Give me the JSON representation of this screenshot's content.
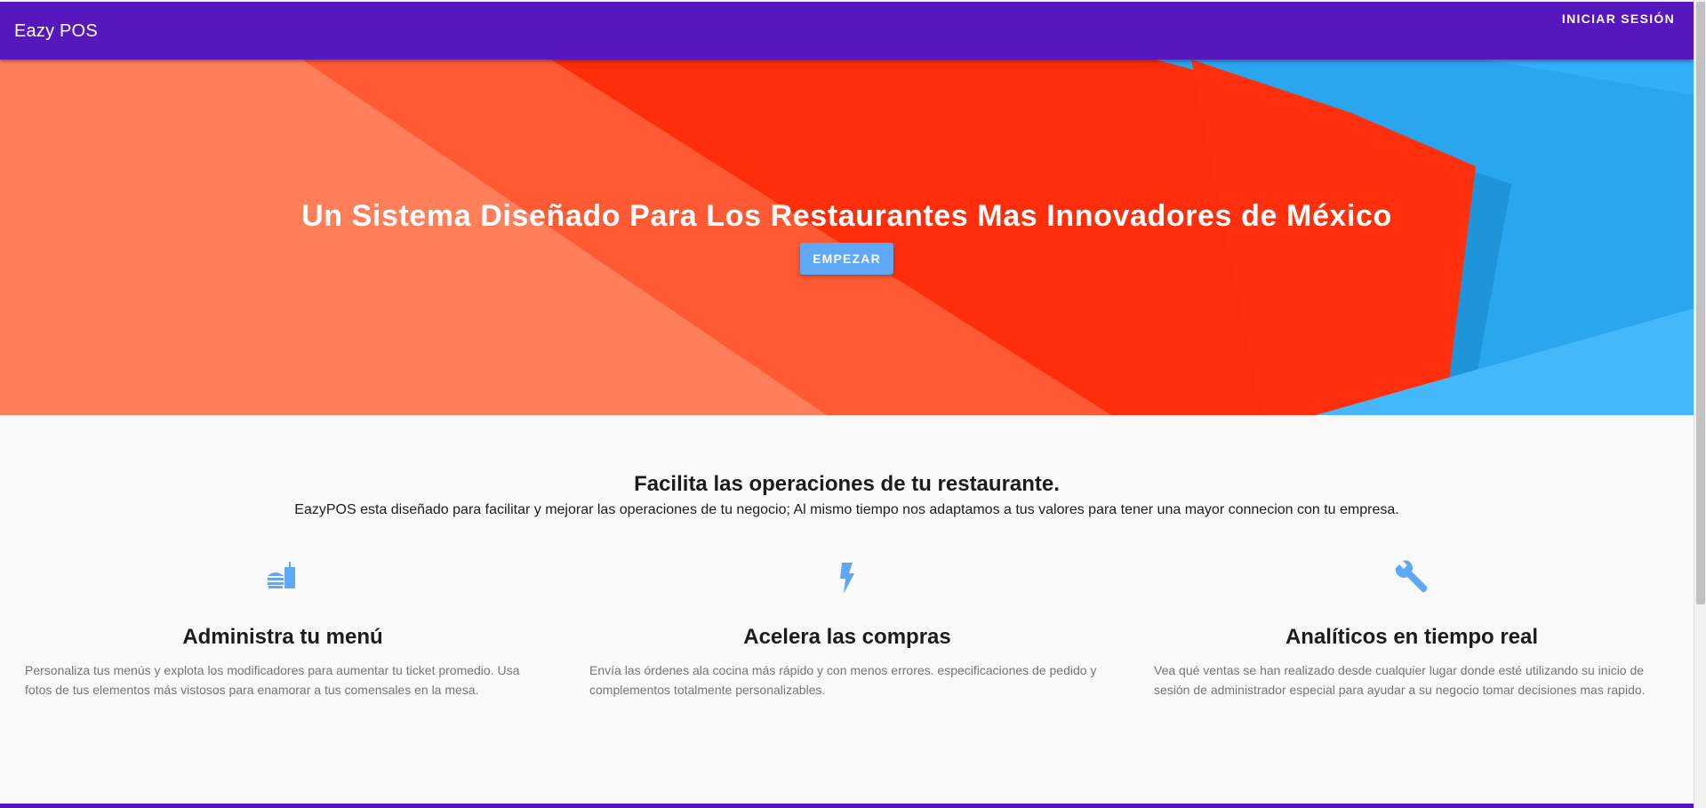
{
  "appbar": {
    "brand": "Eazy POS",
    "login_label": "INICIAR SESIÓN"
  },
  "hero": {
    "headline": "Un Sistema Diseñado Para Los Restaurantes Mas Innovadores de México",
    "cta_label": "EMPEZAR"
  },
  "intro": {
    "title": "Facilita las operaciones de tu restaurante.",
    "description": "EazyPOS esta diseñado para facilitar y mejorar las operaciones de tu negocio; Al mismo tiempo nos adaptamos a tus valores para tener una mayor connecion con tu empresa."
  },
  "features": [
    {
      "icon": "fastfood-icon",
      "title": "Administra tu menú",
      "description": "Personaliza tus menús y explota los modificadores para aumentar tu ticket promedio. Usa fotos de tus elementos más vistosos para enamorar a tus comensales en la mesa."
    },
    {
      "icon": "flash-icon",
      "title": "Acelera las compras",
      "description": "Envía las órdenes ala cocina más rápido y con menos errores. especificaciones de pedido y complementos totalmente personalizables."
    },
    {
      "icon": "wrench-icon",
      "title": "Analíticos en tiempo real",
      "description": "Vea qué ventas se han realizado desde cualquier lugar donde esté utilizando su inicio de sesión de administrador especial para ayudar a su negocio tomar decisiones mas rapido."
    }
  ],
  "colors": {
    "primary": "#5617bd",
    "accent": "#5ea8f6",
    "icon": "#5ea8f6"
  }
}
